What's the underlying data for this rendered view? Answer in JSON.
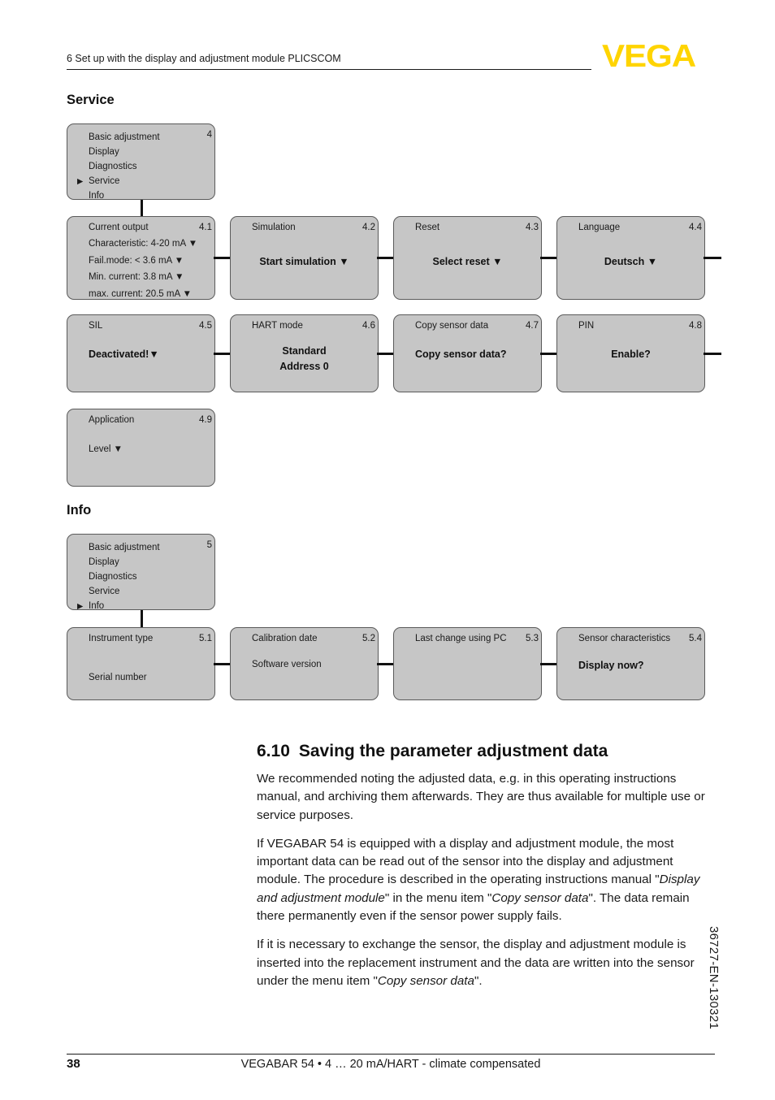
{
  "header": {
    "chapter_text": "6 Set up with the display and adjustment module PLICSCOM",
    "logo": "VEGA"
  },
  "sections": {
    "service_title": "Service",
    "info_title": "Info"
  },
  "service_menu": {
    "number": "4",
    "items": [
      {
        "label": "Basic adjustment",
        "selected": false
      },
      {
        "label": "Display",
        "selected": false
      },
      {
        "label": "Diagnostics",
        "selected": false
      },
      {
        "label": "Service",
        "selected": true
      },
      {
        "label": "Info",
        "selected": false
      }
    ]
  },
  "service_boxes": [
    {
      "title": "Current output",
      "number": "4.1",
      "lines": [
        "Characteristic: 4-20 mA ▼",
        "Fail.mode: < 3.6 mA ▼",
        "Min. current: 3.8 mA ▼",
        "max. current: 20.5 mA ▼"
      ]
    },
    {
      "title": "Simulation",
      "number": "4.2",
      "value": "Start simulation ▼"
    },
    {
      "title": "Reset",
      "number": "4.3",
      "value": "Select reset ▼"
    },
    {
      "title": "Language",
      "number": "4.4",
      "value": "Deutsch ▼"
    },
    {
      "title": "SIL",
      "number": "4.5",
      "value": "Deactivated!▼"
    },
    {
      "title": "HART mode",
      "number": "4.6",
      "value_1": "Standard",
      "value_2": "Address 0"
    },
    {
      "title": "Copy sensor data",
      "number": "4.7",
      "value": "Copy sensor data?"
    },
    {
      "title": "PIN",
      "number": "4.8",
      "value": "Enable?"
    },
    {
      "title": "Application",
      "number": "4.9",
      "value": "Level ▼"
    }
  ],
  "info_menu": {
    "number": "5",
    "items": [
      {
        "label": "Basic adjustment",
        "selected": false
      },
      {
        "label": "Display",
        "selected": false
      },
      {
        "label": "Diagnostics",
        "selected": false
      },
      {
        "label": "Service",
        "selected": false
      },
      {
        "label": "Info",
        "selected": true
      }
    ]
  },
  "info_boxes": [
    {
      "title": "Instrument type",
      "number": "5.1",
      "value": "Serial number"
    },
    {
      "title": "Calibration date",
      "number": "5.2",
      "value": "Software version"
    },
    {
      "title": "Last change using PC",
      "number": "5.3",
      "value": ""
    },
    {
      "title": "Sensor characteristics",
      "number": "5.4",
      "value": "Display now?"
    }
  ],
  "article": {
    "heading_number": "6.10",
    "heading_text": "Saving the parameter adjustment data",
    "paragraph_1": "We recommended noting the adjusted data, e.g. in this operating instructions manual, and archiving them afterwards. They are thus available for multiple use or service purposes.",
    "paragraph_2_a": "If VEGABAR 54 is equipped with a display and adjustment module, the most important data can be read out of the sensor into the display and adjustment module. The procedure is described in the operating instructions manual \"",
    "paragraph_2_italic_1": "Display and adjustment module",
    "paragraph_2_b": "\" in the menu item \"",
    "paragraph_2_italic_2": "Copy sensor data",
    "paragraph_2_c": "\". The data remain there permanently even if the sensor power supply fails.",
    "paragraph_3_a": "If it is necessary to exchange the sensor, the display and adjustment module is inserted into the replacement instrument and the data are written into the sensor under the menu item \"",
    "paragraph_3_italic": "Copy sensor data",
    "paragraph_3_b": "\"."
  },
  "doc_code": "36727-EN-130321",
  "footer": {
    "page_number": "38",
    "title": "VEGABAR 54 • 4 … 20 mA/HART - climate compensated"
  }
}
